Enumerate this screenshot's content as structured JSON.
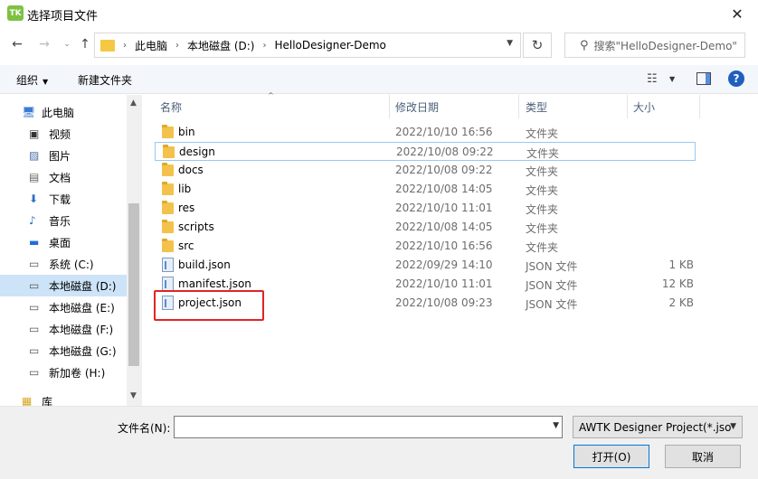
{
  "window": {
    "app_icon": "TK",
    "title": "选择项目文件",
    "close": "✕"
  },
  "navigation": {
    "back": "←",
    "forward": "→",
    "recent": "⌄",
    "up": "↑",
    "breadcrumb": [
      "此电脑",
      "本地磁盘 (D:)",
      "HelloDesigner-Demo"
    ],
    "breadcrumb_sep": "›",
    "refresh": "↻",
    "search_placeholder": "搜索\"HelloDesigner-Demo\""
  },
  "toolbar": {
    "organize": "组织",
    "new_folder": "新建文件夹",
    "help": "?"
  },
  "sidebar": {
    "items": [
      {
        "label": "此电脑",
        "icon": "computer-icon"
      },
      {
        "label": "视频",
        "icon": "video-icon"
      },
      {
        "label": "图片",
        "icon": "pictures-icon"
      },
      {
        "label": "文档",
        "icon": "documents-icon"
      },
      {
        "label": "下载",
        "icon": "download-icon"
      },
      {
        "label": "音乐",
        "icon": "music-icon"
      },
      {
        "label": "桌面",
        "icon": "desktop-icon"
      },
      {
        "label": "系统 (C:)",
        "icon": "drive-icon"
      },
      {
        "label": "本地磁盘 (D:)",
        "icon": "drive-icon"
      },
      {
        "label": "本地磁盘 (E:)",
        "icon": "drive-icon"
      },
      {
        "label": "本地磁盘 (F:)",
        "icon": "drive-icon"
      },
      {
        "label": "本地磁盘 (G:)",
        "icon": "drive-icon"
      },
      {
        "label": "新加卷 (H:)",
        "icon": "drive-icon"
      },
      {
        "label": "库",
        "icon": "library-icon"
      }
    ],
    "selected_index": 8
  },
  "filelist": {
    "columns": [
      "名称",
      "修改日期",
      "类型",
      "大小"
    ],
    "rows": [
      {
        "name": "bin",
        "date": "2022/10/10 16:56",
        "type": "文件夹",
        "size": "",
        "kind": "folder"
      },
      {
        "name": "design",
        "date": "2022/10/08 09:22",
        "type": "文件夹",
        "size": "",
        "kind": "folder"
      },
      {
        "name": "docs",
        "date": "2022/10/08 09:22",
        "type": "文件夹",
        "size": "",
        "kind": "folder"
      },
      {
        "name": "lib",
        "date": "2022/10/08 14:05",
        "type": "文件夹",
        "size": "",
        "kind": "folder"
      },
      {
        "name": "res",
        "date": "2022/10/10 11:01",
        "type": "文件夹",
        "size": "",
        "kind": "folder"
      },
      {
        "name": "scripts",
        "date": "2022/10/08 14:05",
        "type": "文件夹",
        "size": "",
        "kind": "folder"
      },
      {
        "name": "src",
        "date": "2022/10/10 16:56",
        "type": "文件夹",
        "size": "",
        "kind": "folder"
      },
      {
        "name": "build.json",
        "date": "2022/09/29 14:10",
        "type": "JSON 文件",
        "size": "1 KB",
        "kind": "json"
      },
      {
        "name": "manifest.json",
        "date": "2022/10/10 11:01",
        "type": "JSON 文件",
        "size": "12 KB",
        "kind": "json"
      },
      {
        "name": "project.json",
        "date": "2022/10/08 09:23",
        "type": "JSON 文件",
        "size": "2 KB",
        "kind": "json"
      }
    ],
    "hover_index": 1,
    "highlighted_index": 9,
    "highlight_color": "#e32323"
  },
  "footer": {
    "filename_label": "文件名(N):",
    "filename_value": "",
    "filetype_value": "AWTK Designer Project(*.jso",
    "open_label": "打开(O)",
    "cancel_label": "取消"
  },
  "colors": {
    "selection": "#cde3f7",
    "hover_border": "#99c9ef",
    "folder": "#f3c24d",
    "accent": "#0078d7"
  }
}
